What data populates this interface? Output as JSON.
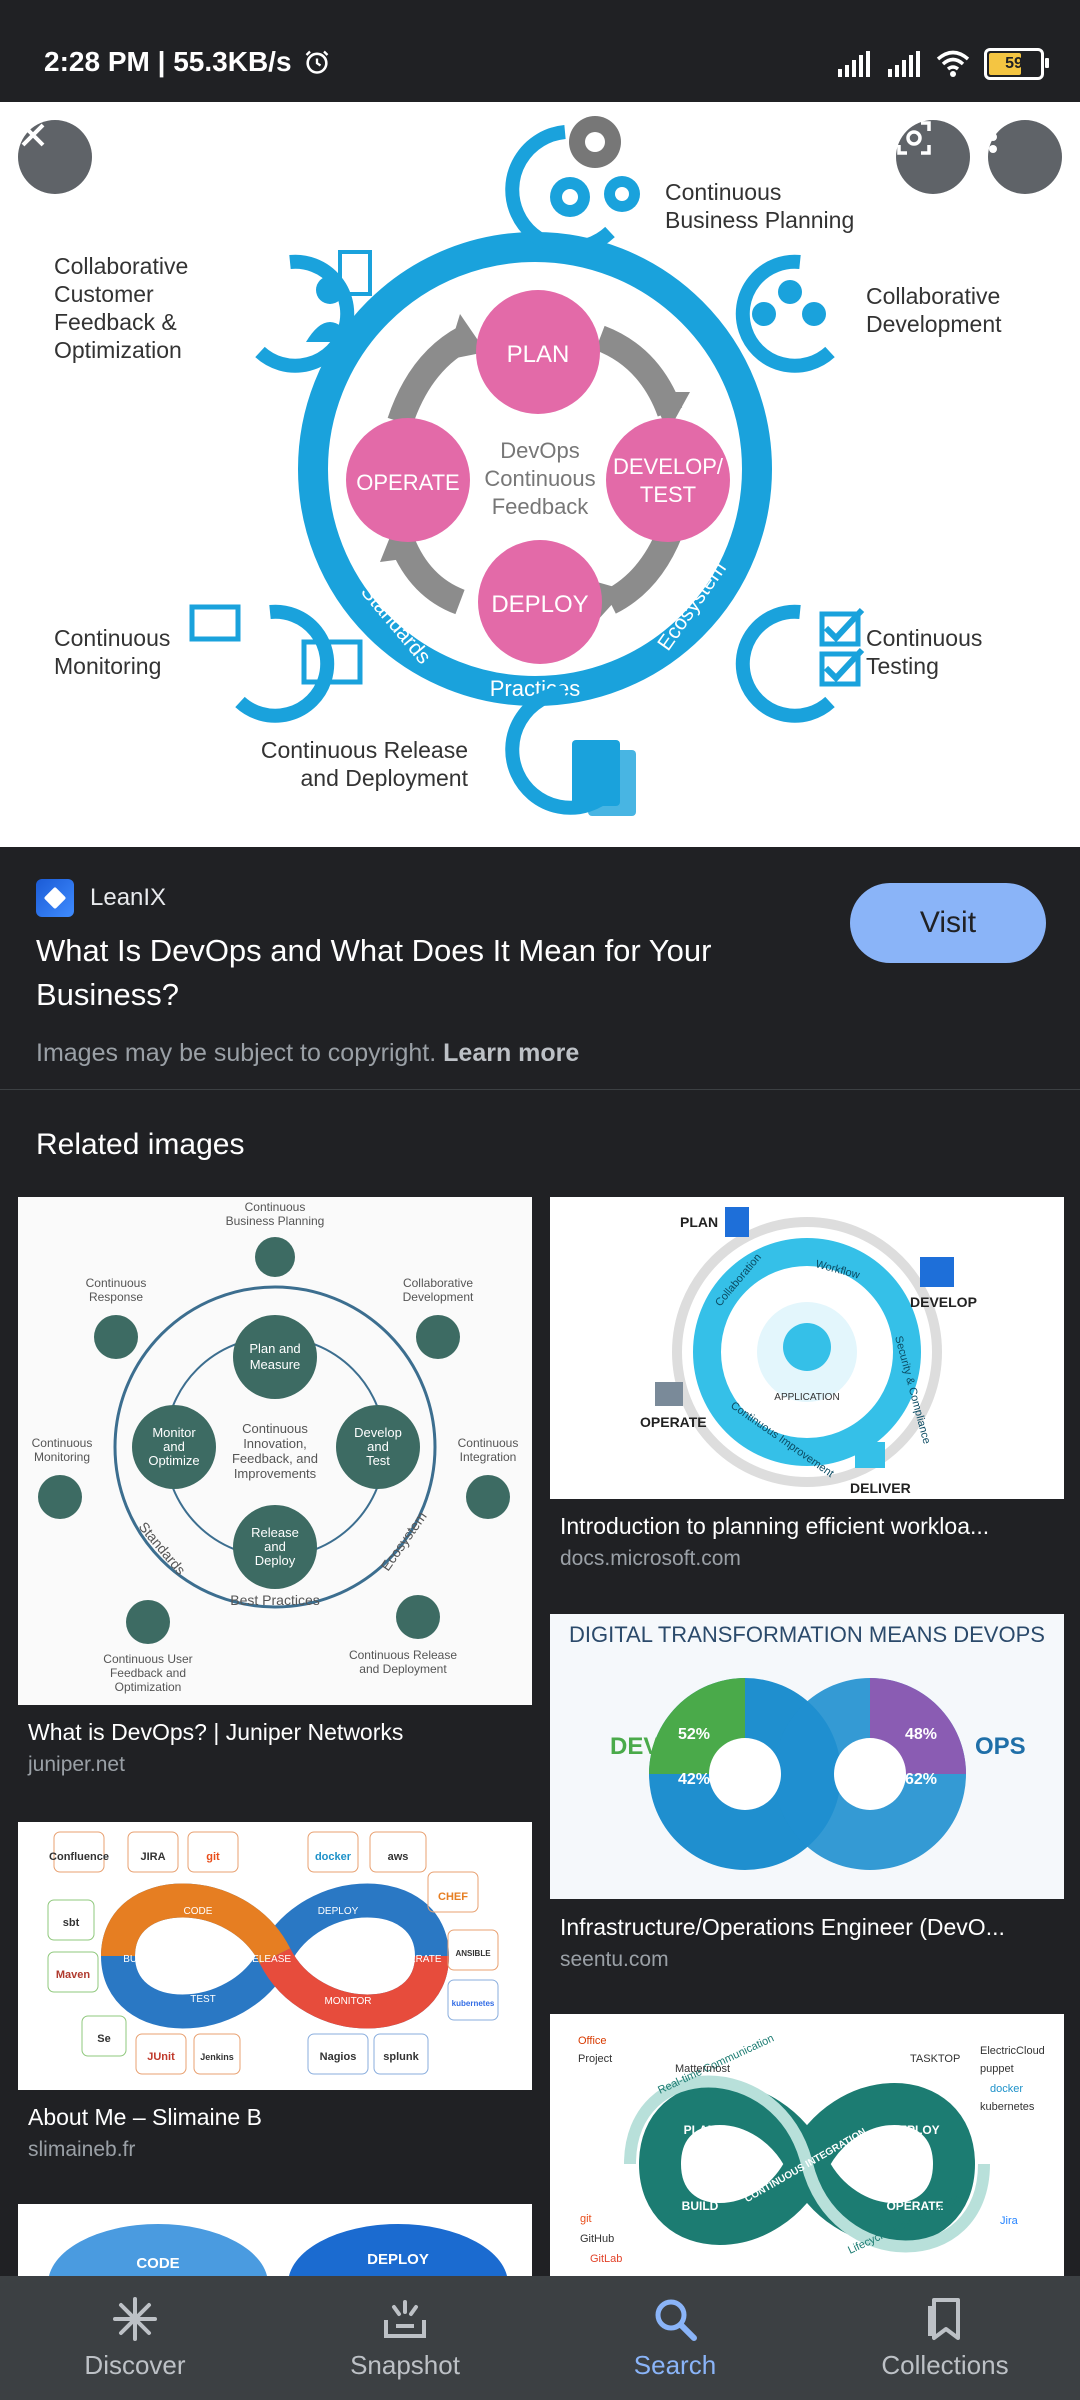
{
  "status": {
    "time": "2:28 PM",
    "speed": "55.3KB/s",
    "battery": "59"
  },
  "hero": {
    "center_text": [
      "DevOps",
      "Continuous",
      "Feedback"
    ],
    "stages": [
      "PLAN",
      "DEVELOP/",
      "TEST",
      "DEPLOY",
      "OPERATE"
    ],
    "ring_labels": [
      "Standards",
      "Practices",
      "Ecosystem"
    ],
    "outer_labels": {
      "planning": [
        "Continuous",
        "Business Planning"
      ],
      "development": [
        "Collaborative",
        "Development"
      ],
      "testing": [
        "Continuous",
        "Testing"
      ],
      "release": [
        "Continuous Release",
        "and Deployment"
      ],
      "monitoring": [
        "Continuous",
        "Monitoring"
      ],
      "feedback": [
        "Collaborative",
        "Customer",
        "Feedback &",
        "Optimization"
      ]
    }
  },
  "result": {
    "source": "LeanIX",
    "title": "What Is DevOps and What Does It Mean for Your Business?",
    "visit_label": "Visit",
    "copyright_text": "Images may be subject to copyright.",
    "learn_more": "Learn more"
  },
  "related_heading": "Related images",
  "related": [
    {
      "title": "What is DevOps? | Juniper Networks",
      "source": "juniper.net",
      "thumb": {
        "center": [
          "Continuous",
          "Innovation,",
          "Feedback, and",
          "Improvements"
        ],
        "nodes": [
          [
            "Plan and",
            "Measure"
          ],
          [
            "Develop",
            "and",
            "Test"
          ],
          [
            "Release",
            "and",
            "Deploy"
          ],
          [
            "Monitor",
            "and",
            "Optimize"
          ]
        ],
        "outer": {
          "top": [
            "Continuous",
            "Business Planning"
          ],
          "top_right": [
            "Collaborative",
            "Development"
          ],
          "right": [
            "Continuous",
            "Integration"
          ],
          "bottom_right": [
            "Continuous Release",
            "and Deployment"
          ],
          "bottom_left": [
            "Continuous User",
            "Feedback and",
            "Optimization"
          ],
          "left": [
            "Continuous",
            "Monitoring"
          ],
          "top_left": [
            "Continuous",
            "Response"
          ]
        },
        "ring": [
          "Standards",
          "Best Practices",
          "Ecosystem"
        ]
      }
    },
    {
      "title": "Introduction to planning efficient workloa...",
      "source": "docs.microsoft.com",
      "thumb": {
        "corners": [
          "PLAN",
          "DEVELOP",
          "DELIVER",
          "OPERATE"
        ],
        "ring": [
          "Collaboration",
          "Workflow",
          "Security & Compliance",
          "Continuous Improvement"
        ],
        "center": "APPLICATION"
      }
    },
    {
      "title": "About Me – Slimaine B",
      "source": "slimaineb.fr",
      "thumb": {
        "tools": [
          "Confluence",
          "JIRA",
          "git",
          "docker",
          "aws",
          "CHEF",
          "sbt",
          "Maven",
          "Se",
          "JUnit",
          "Jenkins",
          "Nagios",
          "splunk",
          "ANSIBLE",
          "kubernetes"
        ],
        "loop": [
          "CODE",
          "BUILD",
          "TEST",
          "RELEASE",
          "DEPLOY",
          "OPERATE",
          "MONITOR"
        ]
      }
    },
    {
      "title": "Infrastructure/Operations Engineer (DevO...",
      "source": "seentu.com",
      "thumb": {
        "heading": "DIGITAL TRANSFORMATION MEANS DEVOPS",
        "left": "DEV",
        "right": "OPS",
        "percents": [
          "52%",
          "42%",
          "48%",
          "62%"
        ]
      }
    },
    {
      "thumb": {
        "tools": [
          "Office",
          "Project",
          "Mattermost",
          "TASKTOP",
          "ElectricCloud",
          "puppet",
          "docker",
          "kubernetes",
          "git",
          "GitHub",
          "GitLab",
          "Jira"
        ],
        "loop": [
          "PLAN",
          "BUILD",
          "CONTINUOUS INTEGRATION",
          "DEPLOY",
          "OPERATE"
        ],
        "bands": [
          "Real-time Communication",
          "Lifecycle-wide Traceability"
        ]
      }
    },
    {
      "thumb": {
        "labels": [
          "CODE",
          "DEPLOY"
        ]
      }
    }
  ],
  "nav": [
    {
      "label": "Discover",
      "icon": "asterisk-icon"
    },
    {
      "label": "Snapshot",
      "icon": "snapshot-icon"
    },
    {
      "label": "Search",
      "icon": "search-icon"
    },
    {
      "label": "Collections",
      "icon": "collections-icon"
    }
  ],
  "colors": {
    "accent": "#8ab4f8",
    "devops_blue": "#1aa2dc",
    "devops_pink": "#e36aa8",
    "background": "#202124"
  }
}
